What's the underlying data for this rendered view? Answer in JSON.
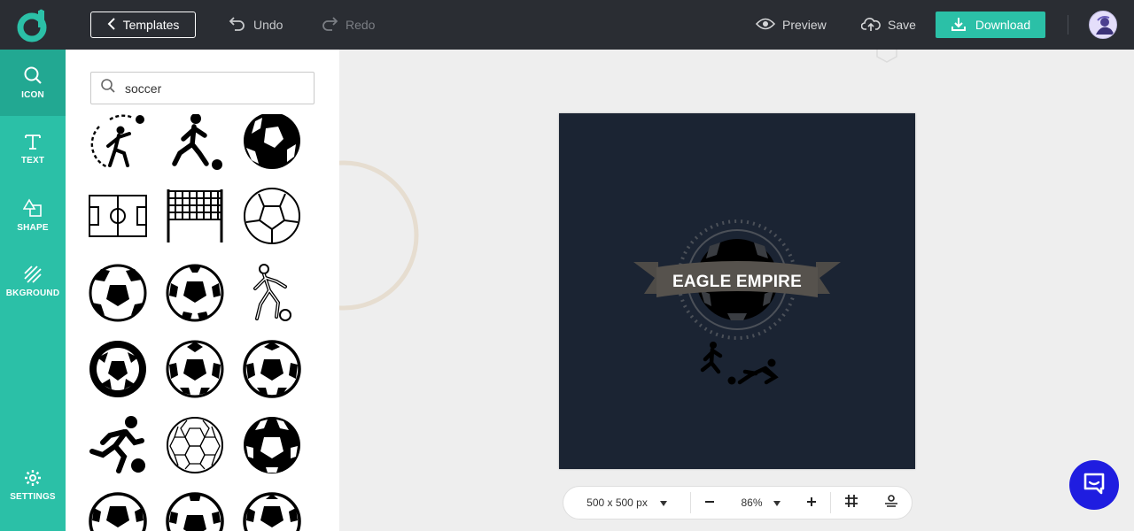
{
  "toolbar": {
    "templates_label": "Templates",
    "undo_label": "Undo",
    "redo_label": "Redo",
    "preview_label": "Preview",
    "save_label": "Save",
    "download_label": "Download"
  },
  "rail": {
    "items": [
      {
        "label": "ICON",
        "icon": "search-icon",
        "active": true
      },
      {
        "label": "TEXT",
        "icon": "text-icon",
        "active": false
      },
      {
        "label": "SHAPE",
        "icon": "shape-icon",
        "active": false
      },
      {
        "label": "BKGROUND",
        "icon": "background-icon",
        "active": false
      }
    ],
    "settings_label": "SETTINGS"
  },
  "search": {
    "value": "soccer"
  },
  "icon_results": [
    "player-kicking-ball-arc-icon",
    "player-dribbling-icon",
    "soccer-ball-icon",
    "soccer-field-icon",
    "goal-net-icon",
    "soccer-ball-outline-icon",
    "soccer-ball-icon",
    "soccer-ball-icon",
    "player-outline-icon",
    "soccer-ball-icon",
    "soccer-ball-icon",
    "soccer-ball-icon",
    "player-running-ball-icon",
    "soccer-ball-hex-outline-icon",
    "soccer-ball-icon",
    "soccer-ball-icon",
    "soccer-ball-icon",
    "soccer-ball-icon"
  ],
  "design": {
    "badge_text": "EAGLE EMPIRE",
    "background_color": "#1b2433"
  },
  "controls": {
    "size_label": "500 x 500 px",
    "zoom_label": "86%"
  },
  "colors": {
    "accent": "#2bc0a7",
    "topbar": "#2a2d33",
    "chat": "#1f1de0"
  }
}
